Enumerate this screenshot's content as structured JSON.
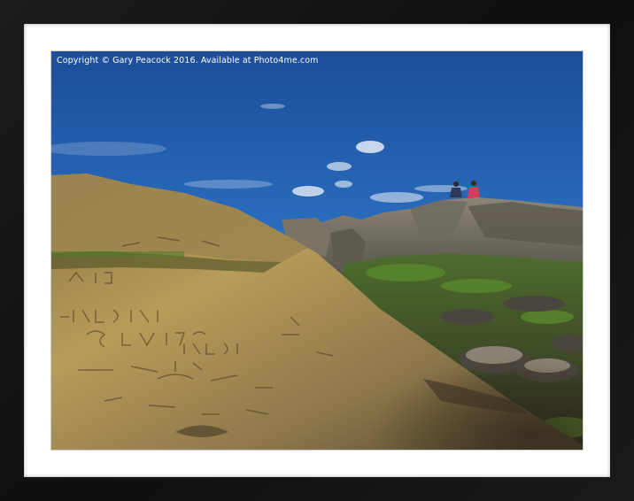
{
  "watermark": {
    "text": "Copyright  © Gary Peacock  2016. Available at Photo4me.com"
  },
  "scene": {
    "subject": "people-sitting-on-rock",
    "palette": {
      "sky_top": "#1c4f9e",
      "sky_bottom": "#7ab3e0",
      "rock_light": "#b59a57",
      "rock_dark": "#3d3424",
      "grass": "#4f7a2a",
      "frame": "#151515",
      "mat": "#ffffff"
    }
  }
}
